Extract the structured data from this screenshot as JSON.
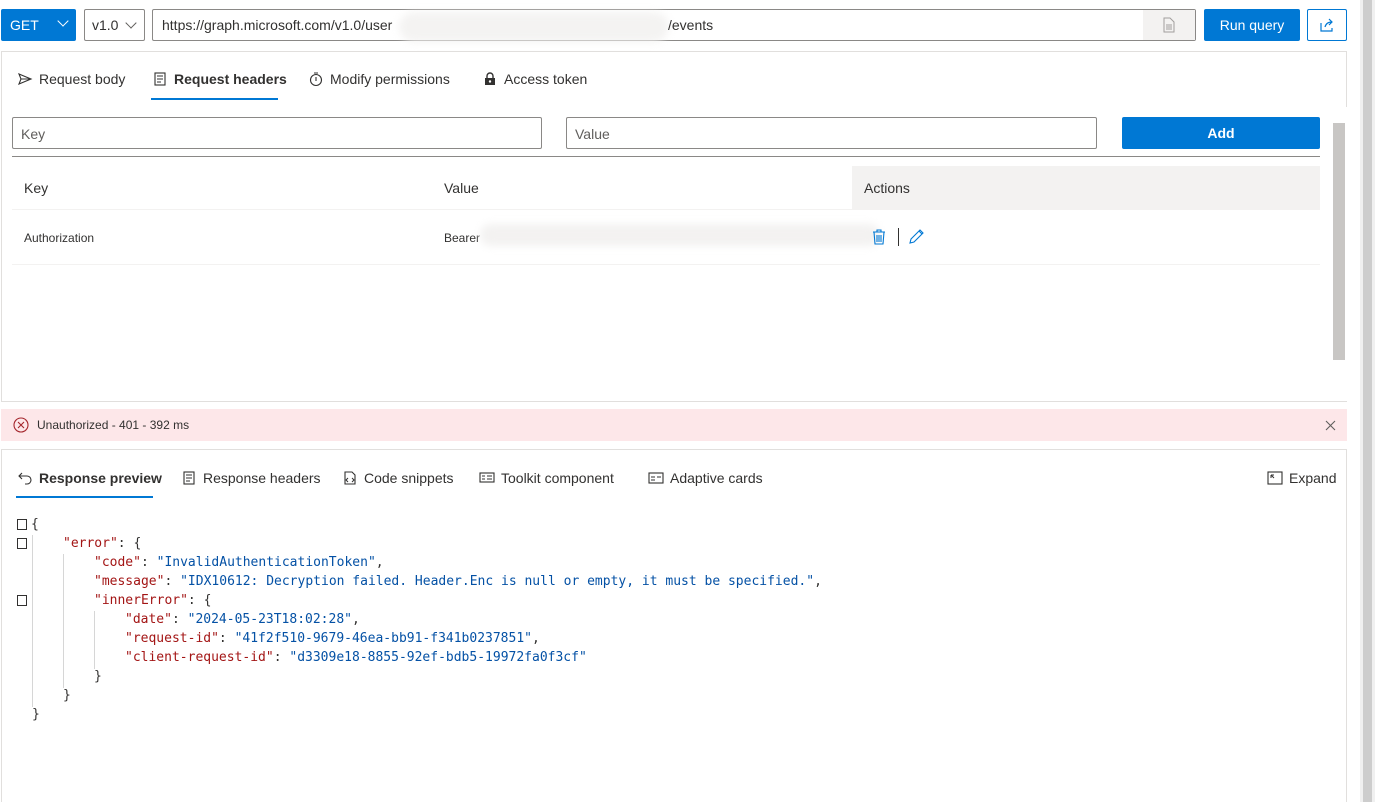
{
  "toolbar": {
    "method": "GET",
    "version": "v1.0",
    "url_prefix": "https://graph.microsoft.com/v1.0/user",
    "url_suffix": "/events",
    "run_label": "Run query"
  },
  "request_tabs": [
    {
      "label": "Request body",
      "icon": "send-icon"
    },
    {
      "label": "Request headers",
      "icon": "header-icon",
      "active": true
    },
    {
      "label": "Modify permissions",
      "icon": "permissions-icon"
    },
    {
      "label": "Access token",
      "icon": "lock-icon"
    }
  ],
  "headers_form": {
    "key_placeholder": "Key",
    "value_placeholder": "Value",
    "add_label": "Add"
  },
  "headers_table": {
    "columns": [
      "Key",
      "Value",
      "Actions"
    ],
    "rows": [
      {
        "key": "Authorization",
        "value": "Bearer"
      }
    ]
  },
  "status": {
    "text": "Unauthorized - 401 - 392 ms",
    "color": "#fde7e9"
  },
  "response_tabs": [
    {
      "label": "Response preview",
      "icon": "undo-icon",
      "active": true
    },
    {
      "label": "Response headers",
      "icon": "header-icon"
    },
    {
      "label": "Code snippets",
      "icon": "code-icon"
    },
    {
      "label": "Toolkit component",
      "icon": "toolkit-icon"
    },
    {
      "label": "Adaptive cards",
      "icon": "card-icon"
    }
  ],
  "expand_label": "Expand",
  "response": {
    "error_key": "\"error\"",
    "code_key": "\"code\"",
    "code_val": "\"InvalidAuthenticationToken\"",
    "message_key": "\"message\"",
    "message_val": "\"IDX10612: Decryption failed. Header.Enc is null or empty, it must be specified.\"",
    "inner_key": "\"innerError\"",
    "date_key": "\"date\"",
    "date_val": "\"2024-05-23T18:02:28\"",
    "reqid_key": "\"request-id\"",
    "reqid_val": "\"41f2f510-9679-46ea-bb91-f341b0237851\"",
    "clientid_key": "\"client-request-id\"",
    "clientid_val": "\"d3309e18-8855-92ef-bdb5-19972fa0f3cf\""
  },
  "colors": {
    "accent": "#0078d4",
    "json_key": "#a31515",
    "json_string": "#0451a5"
  }
}
